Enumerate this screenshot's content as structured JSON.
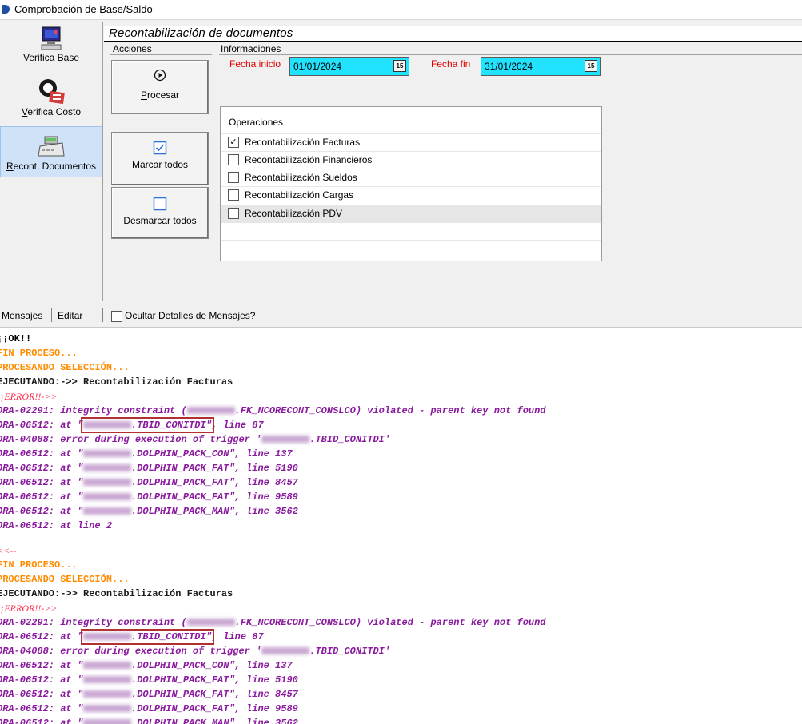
{
  "window": {
    "title": "Comprobación de Base/Saldo"
  },
  "sidebar": {
    "items": [
      {
        "label": "Verifica Base",
        "ul": "V",
        "rest": "erifica Base",
        "icon": "computer-icon"
      },
      {
        "label": "Verifica Costo",
        "ul": "V",
        "rest": "erifica Costo",
        "icon": "magnifier-icon"
      },
      {
        "label": "Recont. Documentos",
        "ul": "R",
        "rest": "econt. Documentos",
        "icon": "cash-register-icon",
        "active": true
      }
    ]
  },
  "header": {
    "title": "Recontabilización de documentos"
  },
  "acciones": {
    "label": "Acciones",
    "buttons": [
      {
        "ul": "P",
        "rest": "rocesar",
        "label": "Procesar",
        "icon": "play-icon"
      },
      {
        "ul": "M",
        "rest": "arcar todos",
        "label": "Marcar todos",
        "icon": "check-box-icon"
      },
      {
        "ul": "D",
        "rest": "esmarcar todos",
        "label": "Desmarcar todos",
        "icon": "empty-box-icon"
      }
    ]
  },
  "informaciones": {
    "label": "Informaciones",
    "fecha_inicio": {
      "label": "Fecha inicio",
      "value": "01/01/2024"
    },
    "fecha_fin": {
      "label": "Fecha fin",
      "value": "31/01/2024"
    },
    "calendar_glyph": "15"
  },
  "operaciones": {
    "label": "Operaciones",
    "items": [
      {
        "label": "Recontabilización Facturas",
        "checked": true
      },
      {
        "label": "Recontabilización Financieros",
        "checked": false
      },
      {
        "label": "Recontabilización Sueldos",
        "checked": false
      },
      {
        "label": "Recontabilización Cargas",
        "checked": false
      },
      {
        "label": "Recontabilización PDV",
        "checked": false,
        "highlighted": true
      }
    ]
  },
  "tabs": {
    "mensajes": "Mensajes",
    "editar_ul": "E",
    "editar_rest": "ditar",
    "ocultar": "Ocultar Detalles de Mensajes?"
  },
  "messages": {
    "ok": "¡¡OK!!",
    "fin": "FIN PROCESO...",
    "procesando": "PROCESANDO SELECCIÓN...",
    "ejecutando": "EJECUTANDO:->> Recontabilización Facturas",
    "error": "¡¡ERROR!!->>",
    "l1a": "ORA-02291: integrity constraint (",
    "l1b": ".FK_NCORECONT_CONSLCO) violated - parent key not found",
    "l2a": "ORA-06512: at \"",
    "l2b": ".TBID_CONITDI\"",
    "l2c": ", line 87",
    "l3a": "ORA-04088: error during execution of trigger '",
    "l3b": ".TBID_CONITDI'",
    "l4": ".DOLPHIN_PACK_CON\", line 137",
    "l5": ".DOLPHIN_PACK_FAT\", line 5190",
    "l6": ".DOLPHIN_PACK_FAT\", line 8457",
    "l7": ".DOLPHIN_PACK_FAT\", line 9589",
    "l8": ".DOLPHIN_PACK_MAN\", line 3562",
    "l9": "ORA-06512: at line 2",
    "end": "<<--"
  }
}
